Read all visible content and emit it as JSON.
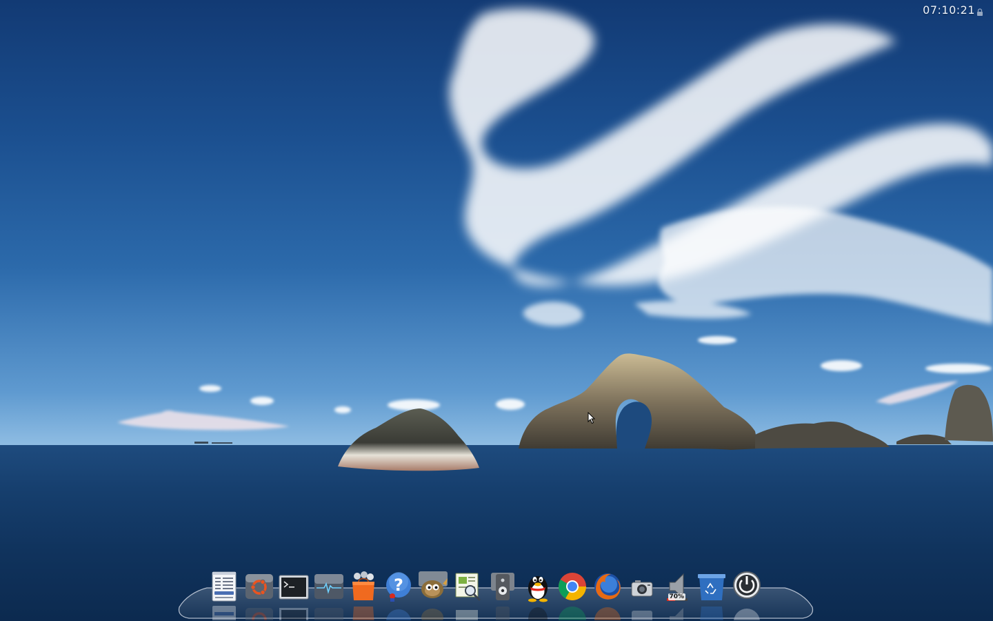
{
  "top_bar": {
    "clock": "07:10:21",
    "lock_icon": "lock-icon"
  },
  "dock": {
    "items": [
      {
        "name": "file-manager",
        "icon": "file-cabinet-icon"
      },
      {
        "name": "ubuntu-software",
        "icon": "ubuntu-logo-icon"
      },
      {
        "name": "terminal",
        "icon": "terminal-icon"
      },
      {
        "name": "system-monitor",
        "icon": "heartbeat-monitor-icon"
      },
      {
        "name": "software-store",
        "icon": "shopping-bag-icon"
      },
      {
        "name": "help",
        "icon": "help-question-icon"
      },
      {
        "name": "gimp",
        "icon": "gimp-wilber-icon"
      },
      {
        "name": "document-viewer",
        "icon": "document-viewer-icon"
      },
      {
        "name": "media-player",
        "icon": "speaker-player-icon"
      },
      {
        "name": "qq",
        "icon": "qq-penguin-icon"
      },
      {
        "name": "chrome",
        "icon": "chrome-browser-icon"
      },
      {
        "name": "firefox",
        "icon": "firefox-browser-icon"
      },
      {
        "name": "screenshot",
        "icon": "camera-icon"
      },
      {
        "name": "volume",
        "icon": "volume-speaker-icon",
        "label": "70%"
      },
      {
        "name": "trash",
        "icon": "recycle-bin-icon"
      },
      {
        "name": "shutdown",
        "icon": "power-icon"
      }
    ]
  },
  "colors": {
    "sky_top": "#123a74",
    "sea": "#163f6e",
    "clock_text": "#eef3fa"
  }
}
